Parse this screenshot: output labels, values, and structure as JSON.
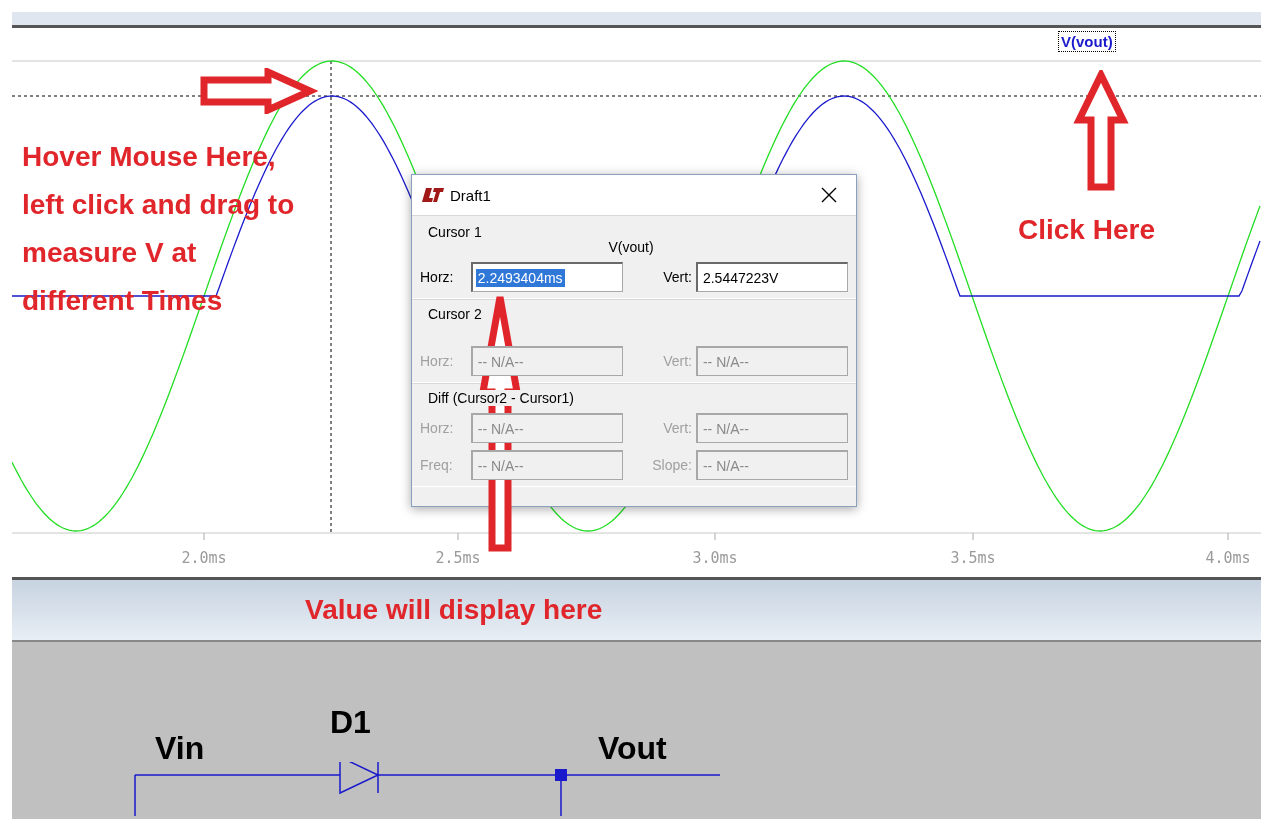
{
  "plot": {
    "trace_label": "V(vout)",
    "trace_label_selected": true,
    "x_ticks": [
      "2.0ms",
      "2.5ms",
      "3.0ms",
      "3.5ms",
      "4.0ms"
    ]
  },
  "dialog": {
    "title": "Draft1",
    "sections": [
      {
        "title": "Cursor 1",
        "trace": "V(vout)",
        "rows": [
          [
            {
              "label": "Horz:",
              "value": "2.2493404ms",
              "disabled": false,
              "text_selected": true
            },
            {
              "label": "Vert:",
              "value": "2.5447223V",
              "disabled": false,
              "text_selected": false
            }
          ]
        ]
      },
      {
        "title": "Cursor 2",
        "rows": [
          [
            {
              "label": "Horz:",
              "value": "-- N/A--",
              "disabled": true,
              "text_selected": false
            },
            {
              "label": "Vert:",
              "value": "-- N/A--",
              "disabled": true,
              "text_selected": false
            }
          ]
        ]
      },
      {
        "title": "Diff (Cursor2 - Cursor1)",
        "rows": [
          [
            {
              "label": "Horz:",
              "value": "-- N/A--",
              "disabled": true,
              "text_selected": false
            },
            {
              "label": "Vert:",
              "value": "-- N/A--",
              "disabled": true,
              "text_selected": false
            }
          ],
          [
            {
              "label": "Freq:",
              "value": "-- N/A--",
              "disabled": true,
              "text_selected": false
            },
            {
              "label": "Slope:",
              "value": "-- N/A--",
              "disabled": true,
              "text_selected": false
            }
          ]
        ]
      }
    ]
  },
  "annotations": {
    "hover_note": "Hover Mouse Here,\nleft click and drag to\nmeasure V at\ndifferent Times",
    "click_note": "Click Here",
    "value_note": "Value will display here"
  },
  "schematic": {
    "labels": [
      {
        "kind": "part",
        "text": "D1"
      },
      {
        "kind": "net",
        "text": "Vin"
      },
      {
        "kind": "net",
        "text": "Vout"
      }
    ]
  }
}
